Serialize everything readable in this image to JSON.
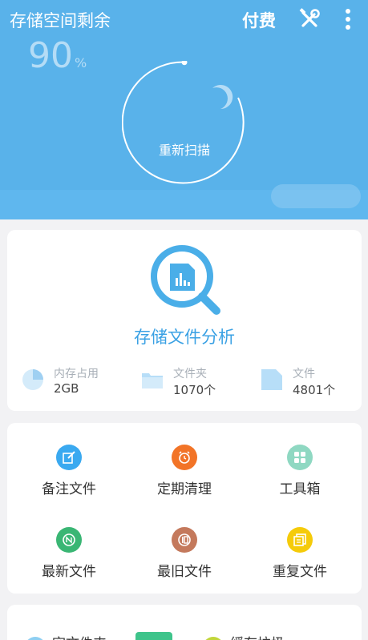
{
  "header": {
    "title": "存储空间剩余",
    "pay_label": "付费",
    "remaining_percent": "90",
    "percent_sign": "%",
    "rescan_label": "重新扫描",
    "tools_icon": "wrench-screwdriver-icon",
    "more_icon": "more-vertical-icon"
  },
  "analysis": {
    "title": "存储文件分析",
    "icon": "storage-search-icon",
    "stats": [
      {
        "label": "内存占用",
        "value": "2GB",
        "icon": "pie-chart-icon"
      },
      {
        "label": "文件夹",
        "value": "1070个",
        "icon": "folder-icon"
      },
      {
        "label": "文件",
        "value": "4801个",
        "icon": "file-icon"
      }
    ]
  },
  "tools": [
    {
      "label": "备注文件",
      "icon": "edit-note-icon",
      "color": "#3aa9f0"
    },
    {
      "label": "定期清理",
      "icon": "alarm-clock-icon",
      "color": "#f27427"
    },
    {
      "label": "工具箱",
      "icon": "toolbox-grid-icon",
      "color": "#8fd8c2"
    },
    {
      "label": "最新文件",
      "icon": "new-file-icon",
      "color": "#3ab674"
    },
    {
      "label": "最旧文件",
      "icon": "old-file-icon",
      "color": "#c4795c"
    },
    {
      "label": "重复文件",
      "icon": "duplicate-file-icon",
      "color": "#f5cb0a"
    }
  ],
  "bottom": {
    "items": [
      {
        "label": "空文件夹",
        "icon": "empty-folder-icon",
        "color": "#8ecff2"
      },
      {
        "label": "缓存垃圾",
        "icon": "cache-junk-icon",
        "color": "#c2d63a"
      }
    ]
  },
  "colors": {
    "header_bg": "#59b2ea",
    "accent": "#3aa1e4",
    "page_bg": "#f2f2f4"
  }
}
